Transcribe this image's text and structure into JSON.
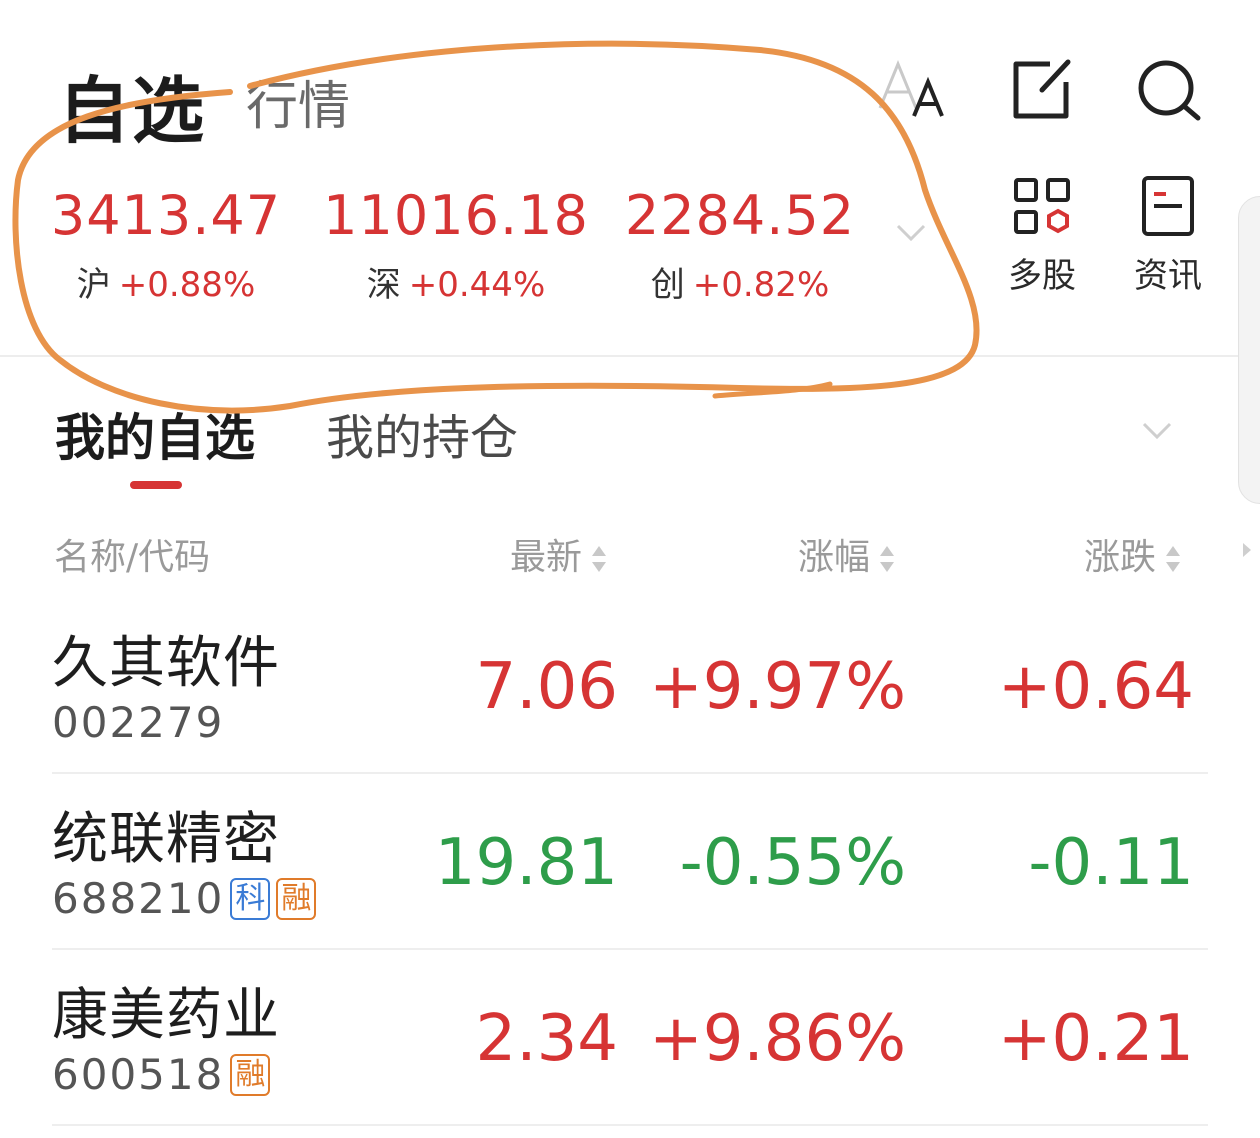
{
  "header": {
    "tab_active": "自选",
    "tab_market": "行情"
  },
  "indices": [
    {
      "value": "3413.47",
      "name": "沪",
      "change": "+0.88%"
    },
    {
      "value": "11016.18",
      "name": "深",
      "change": "+0.44%"
    },
    {
      "value": "2284.52",
      "name": "创",
      "change": "+0.82%"
    }
  ],
  "side_buttons": {
    "multi_stock": "多股",
    "news": "资讯"
  },
  "subtabs": {
    "watchlist": "我的自选",
    "positions": "我的持仓"
  },
  "columns": {
    "name_code": "名称/代码",
    "latest": "最新",
    "change_pct": "涨幅",
    "change_amt": "涨跌"
  },
  "stocks": [
    {
      "name": "久其软件",
      "code": "002279",
      "price": "7.06",
      "pct": "+9.97%",
      "chg": "+0.64",
      "trend": "up",
      "tags": []
    },
    {
      "name": "统联精密",
      "code": "688210",
      "price": "19.81",
      "pct": "-0.55%",
      "chg": "-0.11",
      "trend": "down",
      "tags": [
        "科",
        "融"
      ]
    },
    {
      "name": "康美药业",
      "code": "600518",
      "price": "2.34",
      "pct": "+9.86%",
      "chg": "+0.21",
      "trend": "up",
      "tags": [
        "融"
      ]
    }
  ],
  "colors": {
    "up": "#d63434",
    "down": "#2e9d4a",
    "annotation": "#e8934a",
    "tag_ke": "#3a7bd5",
    "tag_rong": "#e07b2a"
  }
}
